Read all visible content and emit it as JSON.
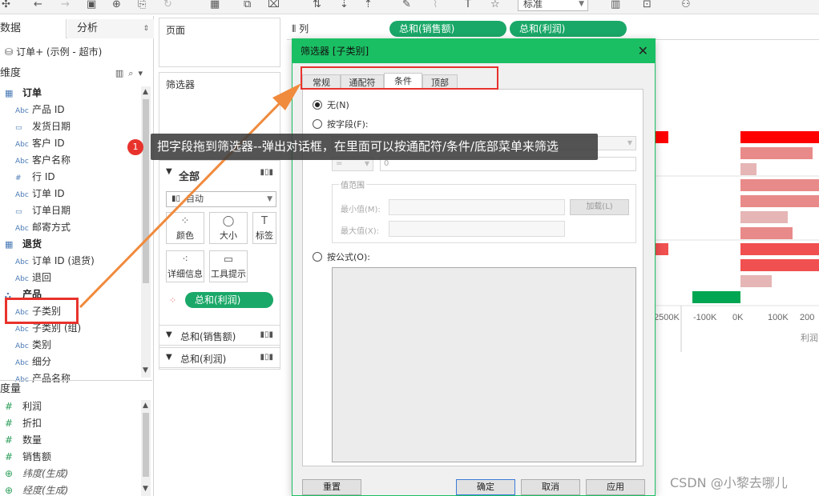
{
  "toolbar": {
    "mark_type_select": "标准"
  },
  "left_pane": {
    "tab_data": "数据",
    "tab_analysis": "分析",
    "datasource": "订单+ (示例 - 超市)",
    "dimensions_label": "维度",
    "dimension_fields": [
      {
        "type": "folder",
        "icon": "▦",
        "label": "订单"
      },
      {
        "type": "Abc",
        "icon": "Abc",
        "label": "产品 ID"
      },
      {
        "type": "date",
        "icon": "▭",
        "label": "发货日期"
      },
      {
        "type": "Abc",
        "icon": "Abc",
        "label": "客户 ID"
      },
      {
        "type": "Abc",
        "icon": "Abc",
        "label": "客户名称"
      },
      {
        "type": "num",
        "icon": "#",
        "label": "行 ID"
      },
      {
        "type": "Abc",
        "icon": "Abc",
        "label": "订单 ID"
      },
      {
        "type": "date",
        "icon": "▭",
        "label": "订单日期"
      },
      {
        "type": "Abc",
        "icon": "Abc",
        "label": "邮寄方式"
      },
      {
        "type": "folder",
        "icon": "▦",
        "label": "退货"
      },
      {
        "type": "Abc",
        "icon": "Abc",
        "label": "订单 ID (退货)"
      },
      {
        "type": "Abc",
        "icon": "Abc",
        "label": "退回"
      },
      {
        "type": "hier",
        "icon": "⛬",
        "label": "产品"
      },
      {
        "type": "Abc",
        "icon": "Abc",
        "label": "子类别"
      },
      {
        "type": "Abc",
        "icon": "Abc",
        "label": "子类别 (组)"
      },
      {
        "type": "Abc",
        "icon": "Abc",
        "label": "类别"
      },
      {
        "type": "Abc",
        "icon": "Abc",
        "label": "细分"
      },
      {
        "type": "Abc",
        "icon": "Abc",
        "label": "产品名称"
      }
    ],
    "measures_label": "度量",
    "measure_fields": [
      {
        "icon": "#",
        "label": "利润",
        "italic": false
      },
      {
        "icon": "#",
        "label": "折扣",
        "italic": false
      },
      {
        "icon": "#",
        "label": "数量",
        "italic": false
      },
      {
        "icon": "#",
        "label": "销售额",
        "italic": false
      },
      {
        "icon": "⊕",
        "label": "纬度(生成)",
        "italic": true
      },
      {
        "icon": "⊕",
        "label": "经度(生成)",
        "italic": true
      }
    ]
  },
  "shelves": {
    "pages_label": "页面",
    "filters_label": "筛选器",
    "columns_label": "列",
    "columns_pills": [
      "总和(销售额)",
      "总和(利润)"
    ],
    "marks_all_label": "全部",
    "marks_type": "自动",
    "mark_buttons": [
      {
        "label": "颜色",
        "icon": "color-icon"
      },
      {
        "label": "大小",
        "icon": "size-icon"
      },
      {
        "label": "标签",
        "icon": "label-icon"
      },
      {
        "label": "详细信息",
        "icon": "detail-icon"
      },
      {
        "label": "工具提示",
        "icon": "tooltip-icon"
      }
    ],
    "color_pill": "总和(利润)",
    "marks_sales_label": "总和(销售额)",
    "marks_profit_label": "总和(利润)"
  },
  "dialog": {
    "title": "筛选器 [子类别]",
    "tabs": [
      "常规",
      "通配符",
      "条件",
      "顶部"
    ],
    "active_tab": "条件",
    "option_none": "无(N)",
    "option_by_field": "按字段(F):",
    "field_select": "",
    "operator_select": "=",
    "value_input": "0",
    "range_group": "值范围",
    "min_label": "最小值(M):",
    "max_label": "最大值(X):",
    "load_button": "加载(L)",
    "option_by_formula": "按公式(O):",
    "reset_button": "重置",
    "ok_button": "确定",
    "cancel_button": "取消",
    "apply_button": "应用"
  },
  "annotation": {
    "badge": "1",
    "text": "把字段拖到筛选器--弹出对话框，在里面可以按通配符/条件/底部菜单来筛选"
  },
  "chart_data": {
    "type": "bar",
    "x_ticks": [
      "2500K",
      "-100K",
      "0K",
      "100K",
      "200"
    ],
    "xlabel": "利润",
    "colors": [
      "#ff0000",
      "#e98a8a",
      "#f05050",
      "#e6b5b5",
      "#00a651"
    ]
  },
  "watermark": "CSDN @小黎去哪儿"
}
